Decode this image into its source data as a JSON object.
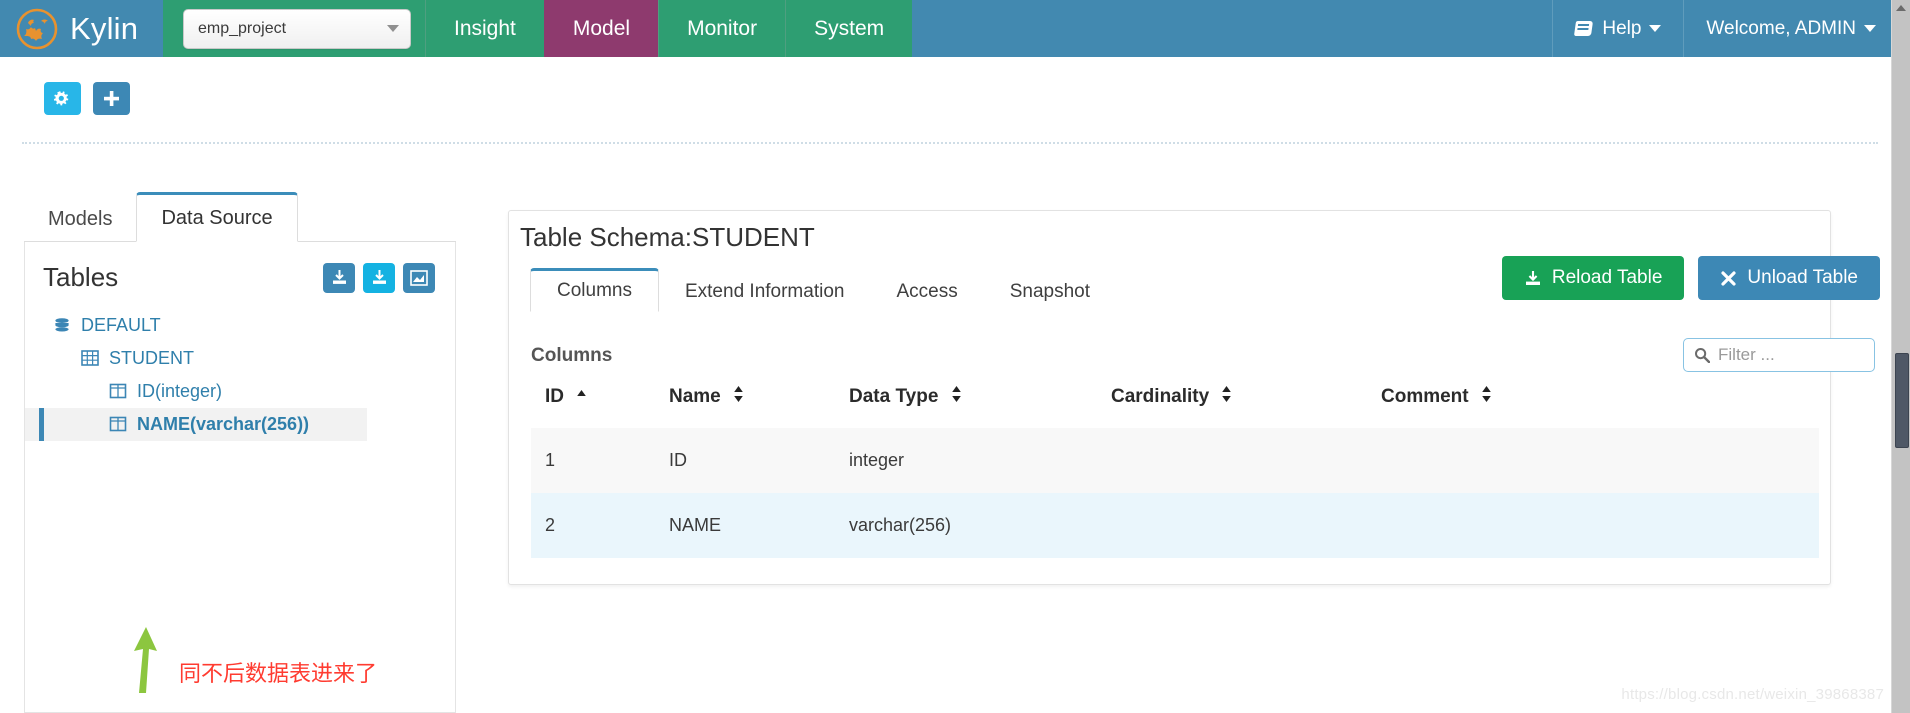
{
  "navbar": {
    "brand": "Kylin",
    "brand_logo_icon": "kylin-logo-icon",
    "project_select": {
      "value": "emp_project",
      "caret_icon": "chevron-down-icon"
    },
    "items": [
      {
        "label": "Insight",
        "active": false
      },
      {
        "label": "Model",
        "active": true
      },
      {
        "label": "Monitor",
        "active": false
      },
      {
        "label": "System",
        "active": false
      }
    ],
    "help": {
      "label": "Help",
      "icon": "book-icon",
      "caret_icon": "chevron-down-icon"
    },
    "user": {
      "label": "Welcome, ADMIN",
      "caret_icon": "chevron-down-icon"
    }
  },
  "toolbar": {
    "buttons": [
      {
        "name": "manage-projects-button",
        "icon": "gears-icon",
        "color": "#28b6e8"
      },
      {
        "name": "add-project-button",
        "icon": "plus-icon",
        "color": "#3d88b5"
      }
    ]
  },
  "left_panel": {
    "tabs": [
      {
        "label": "Models",
        "active": false
      },
      {
        "label": "Data Source",
        "active": true
      }
    ],
    "tables_title": "Tables",
    "table_actions": [
      {
        "name": "load-table-button",
        "icon": "download-table-icon",
        "color": "#3d88b5"
      },
      {
        "name": "load-table-from-tree-button",
        "icon": "download-tree-icon",
        "color": "#14b2e2"
      },
      {
        "name": "snapshot-button",
        "icon": "chart-icon",
        "color": "#3d88b5"
      }
    ],
    "tree": [
      {
        "label": "DEFAULT",
        "level": 0,
        "icon": "database-icon",
        "selected": false
      },
      {
        "label": "STUDENT",
        "level": 1,
        "icon": "table-icon",
        "selected": false
      },
      {
        "label": "ID(integer)",
        "level": 2,
        "icon": "column-icon",
        "selected": false
      },
      {
        "label": "NAME(varchar(256))",
        "level": 2,
        "icon": "column-icon",
        "selected": true
      }
    ],
    "annotation": {
      "text": "同不后数据表进来了",
      "arrow_color": "#8cc63f",
      "text_color": "#ff3b30"
    }
  },
  "content": {
    "schema_title": "Table Schema:STUDENT",
    "tabs": [
      {
        "label": "Columns",
        "active": true
      },
      {
        "label": "Extend Information",
        "active": false
      },
      {
        "label": "Access",
        "active": false
      },
      {
        "label": "Snapshot",
        "active": false
      }
    ],
    "actions": [
      {
        "label": "Reload Table",
        "icon": "download-icon",
        "color": "#18a256"
      },
      {
        "label": "Unload Table",
        "icon": "close-x-icon",
        "color": "#3d88b5"
      }
    ],
    "section_label": "Columns",
    "filter": {
      "placeholder": "Filter ...",
      "value": "",
      "icon": "search-icon"
    },
    "table": {
      "headers": [
        {
          "label": "ID",
          "sort": "asc"
        },
        {
          "label": "Name",
          "sort": "none"
        },
        {
          "label": "Data Type",
          "sort": "none"
        },
        {
          "label": "Cardinality",
          "sort": "none"
        },
        {
          "label": "Comment",
          "sort": "none"
        }
      ],
      "rows": [
        {
          "id": "1",
          "name": "ID",
          "data_type": "integer",
          "cardinality": "",
          "comment": ""
        },
        {
          "id": "2",
          "name": "NAME",
          "data_type": "varchar(256)",
          "cardinality": "",
          "comment": ""
        }
      ]
    }
  },
  "watermark": "https://blog.csdn.net/weixin_39868387"
}
